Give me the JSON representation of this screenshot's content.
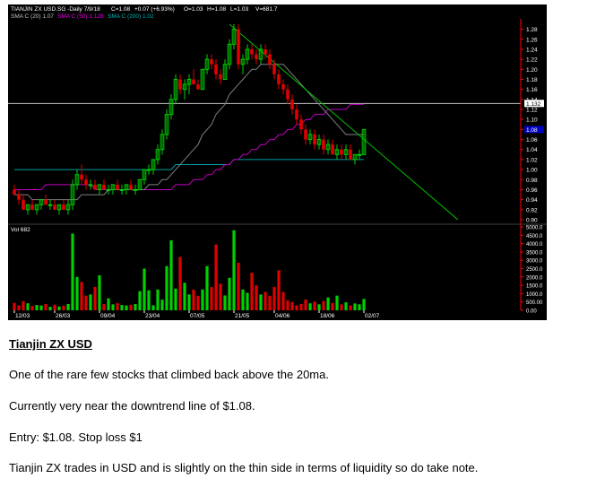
{
  "chart_data": {
    "type": "candlestick",
    "header": {
      "symbol": "TIANJIN ZX USD.SG -Daily  7/9/18",
      "close": "C=1.08",
      "change": "+0.07 (+6.93%)",
      "open": "O=1.03",
      "high": "H=1.08",
      "low": "L=1.03",
      "volume": "V=681.7"
    },
    "ma_legend": {
      "ma20": "SMA C (20) 1.07",
      "ma50": "SMA C (50) 1.128",
      "ma200": "SMA C (200) 1.02"
    },
    "price_axis": {
      "range": [
        0.9,
        1.29
      ],
      "ticks": [
        "1.28",
        "1.26",
        "1.24",
        "1.22",
        "1.20",
        "1.18",
        "1.16",
        "1.14",
        "1.12",
        "1.10",
        "1.08",
        "1.06",
        "1.04",
        "1.02",
        "1.00",
        "0.98",
        "0.96",
        "0.94",
        "0.92",
        "0.90"
      ],
      "tick_values": [
        1.28,
        1.26,
        1.24,
        1.22,
        1.2,
        1.18,
        1.16,
        1.14,
        1.12,
        1.1,
        1.08,
        1.06,
        1.04,
        1.02,
        1.0,
        0.98,
        0.96,
        0.94,
        0.92,
        0.9
      ],
      "marker_line": {
        "value": 1.132,
        "label": "1.132"
      },
      "last_price": {
        "value": 1.08,
        "label": "1.08"
      }
    },
    "volume_legend": "Vol 682",
    "volume_axis": {
      "range": [
        0,
        5000
      ],
      "ticks": [
        "5000.0",
        "4500.0",
        "4000.0",
        "3500.0",
        "3000.0",
        "2500.0",
        "2000.0",
        "1500.0",
        "1000.0",
        "500.00",
        "0.00"
      ],
      "tick_values": [
        5000,
        4500,
        4000,
        3500,
        3000,
        2500,
        2000,
        1500,
        1000,
        500,
        0
      ]
    },
    "x_labels": [
      {
        "label": "12/03",
        "index": 0
      },
      {
        "label": "26/03",
        "index": 9
      },
      {
        "label": "09/04",
        "index": 19
      },
      {
        "label": "23/04",
        "index": 29
      },
      {
        "label": "07/05",
        "index": 39
      },
      {
        "label": "21/05",
        "index": 49
      },
      {
        "label": "04/06",
        "index": 58
      },
      {
        "label": "18/06",
        "index": 68
      },
      {
        "label": "02/07",
        "index": 78
      }
    ],
    "candles": [
      [
        0.96,
        0.97,
        0.95,
        0.95
      ],
      [
        0.95,
        0.96,
        0.93,
        0.94
      ],
      [
        0.94,
        0.95,
        0.92,
        0.92
      ],
      [
        0.92,
        0.93,
        0.91,
        0.93
      ],
      [
        0.93,
        0.94,
        0.92,
        0.92
      ],
      [
        0.92,
        0.93,
        0.91,
        0.93
      ],
      [
        0.93,
        0.94,
        0.92,
        0.94
      ],
      [
        0.94,
        0.95,
        0.93,
        0.93
      ],
      [
        0.93,
        0.94,
        0.92,
        0.93
      ],
      [
        0.93,
        0.94,
        0.92,
        0.92
      ],
      [
        0.92,
        0.93,
        0.91,
        0.93
      ],
      [
        0.93,
        0.94,
        0.92,
        0.92
      ],
      [
        0.92,
        0.94,
        0.91,
        0.93
      ],
      [
        0.93,
        0.98,
        0.92,
        0.97
      ],
      [
        0.97,
        1.0,
        0.96,
        0.99
      ],
      [
        0.99,
        1.01,
        0.97,
        0.98
      ],
      [
        0.98,
        0.99,
        0.96,
        0.97
      ],
      [
        0.97,
        0.98,
        0.96,
        0.97
      ],
      [
        0.97,
        0.98,
        0.96,
        0.96
      ],
      [
        0.96,
        0.97,
        0.95,
        0.97
      ],
      [
        0.97,
        0.98,
        0.96,
        0.96
      ],
      [
        0.96,
        0.97,
        0.95,
        0.96
      ],
      [
        0.96,
        0.97,
        0.95,
        0.97
      ],
      [
        0.97,
        0.98,
        0.96,
        0.96
      ],
      [
        0.96,
        0.97,
        0.95,
        0.96
      ],
      [
        0.96,
        0.97,
        0.95,
        0.97
      ],
      [
        0.97,
        0.98,
        0.96,
        0.96
      ],
      [
        0.96,
        0.97,
        0.95,
        0.96
      ],
      [
        0.96,
        0.98,
        0.96,
        0.98
      ],
      [
        0.98,
        1.0,
        0.97,
        1.0
      ],
      [
        1.0,
        1.01,
        0.99,
        1.0
      ],
      [
        1.0,
        1.02,
        0.99,
        1.02
      ],
      [
        1.02,
        1.05,
        1.01,
        1.04
      ],
      [
        1.04,
        1.08,
        1.03,
        1.07
      ],
      [
        1.07,
        1.12,
        1.06,
        1.11
      ],
      [
        1.11,
        1.15,
        1.1,
        1.14
      ],
      [
        1.14,
        1.19,
        1.13,
        1.18
      ],
      [
        1.18,
        1.19,
        1.15,
        1.16
      ],
      [
        1.16,
        1.18,
        1.14,
        1.17
      ],
      [
        1.17,
        1.19,
        1.15,
        1.18
      ],
      [
        1.18,
        1.2,
        1.17,
        1.17
      ],
      [
        1.17,
        1.18,
        1.16,
        1.16
      ],
      [
        1.16,
        1.2,
        1.16,
        1.2
      ],
      [
        1.2,
        1.23,
        1.19,
        1.22
      ],
      [
        1.22,
        1.23,
        1.2,
        1.21
      ],
      [
        1.21,
        1.22,
        1.18,
        1.19
      ],
      [
        1.19,
        1.2,
        1.17,
        1.18
      ],
      [
        1.18,
        1.22,
        1.18,
        1.21
      ],
      [
        1.21,
        1.26,
        1.2,
        1.25
      ],
      [
        1.25,
        1.29,
        1.24,
        1.28
      ],
      [
        1.28,
        1.29,
        1.2,
        1.21
      ],
      [
        1.21,
        1.23,
        1.19,
        1.22
      ],
      [
        1.22,
        1.25,
        1.21,
        1.24
      ],
      [
        1.24,
        1.25,
        1.22,
        1.23
      ],
      [
        1.23,
        1.24,
        1.21,
        1.22
      ],
      [
        1.22,
        1.25,
        1.21,
        1.24
      ],
      [
        1.24,
        1.25,
        1.22,
        1.23
      ],
      [
        1.23,
        1.24,
        1.2,
        1.21
      ],
      [
        1.21,
        1.22,
        1.18,
        1.19
      ],
      [
        1.19,
        1.2,
        1.16,
        1.17
      ],
      [
        1.17,
        1.18,
        1.15,
        1.16
      ],
      [
        1.16,
        1.17,
        1.13,
        1.14
      ],
      [
        1.14,
        1.15,
        1.11,
        1.12
      ],
      [
        1.12,
        1.13,
        1.09,
        1.1
      ],
      [
        1.1,
        1.11,
        1.07,
        1.08
      ],
      [
        1.08,
        1.09,
        1.05,
        1.06
      ],
      [
        1.06,
        1.08,
        1.05,
        1.07
      ],
      [
        1.07,
        1.08,
        1.04,
        1.05
      ],
      [
        1.05,
        1.07,
        1.04,
        1.06
      ],
      [
        1.06,
        1.07,
        1.03,
        1.04
      ],
      [
        1.04,
        1.06,
        1.03,
        1.05
      ],
      [
        1.05,
        1.06,
        1.03,
        1.03
      ],
      [
        1.03,
        1.05,
        1.02,
        1.04
      ],
      [
        1.04,
        1.05,
        1.02,
        1.03
      ],
      [
        1.03,
        1.05,
        1.02,
        1.04
      ],
      [
        1.04,
        1.05,
        1.02,
        1.02
      ],
      [
        1.02,
        1.03,
        1.01,
        1.03
      ],
      [
        1.03,
        1.04,
        1.02,
        1.03
      ],
      [
        1.03,
        1.08,
        1.03,
        1.08
      ]
    ],
    "volume": [
      450,
      300,
      550,
      420,
      260,
      320,
      290,
      380,
      210,
      340,
      230,
      280,
      380,
      4600,
      2000,
      1700,
      880,
      950,
      1400,
      2100,
      380,
      720,
      360,
      430,
      320,
      290,
      330,
      380,
      1150,
      2500,
      1200,
      300,
      1250,
      640,
      2650,
      4200,
      1300,
      3200,
      1650,
      950,
      1240,
      870,
      1250,
      2650,
      1400,
      3950,
      1600,
      890,
      1950,
      4800,
      2850,
      1250,
      1050,
      2250,
      1500,
      950,
      1100,
      870,
      1400,
      2400,
      1100,
      600,
      500,
      300,
      380,
      650,
      420,
      520,
      360,
      560,
      770,
      440,
      880,
      360,
      480,
      300,
      410,
      360,
      681.7
    ],
    "ma20": [
      0.95,
      0.95,
      0.95,
      0.95,
      0.94,
      0.94,
      0.94,
      0.94,
      0.94,
      0.94,
      0.94,
      0.94,
      0.94,
      0.94,
      0.94,
      0.95,
      0.95,
      0.95,
      0.95,
      0.95,
      0.95,
      0.96,
      0.96,
      0.96,
      0.96,
      0.96,
      0.96,
      0.96,
      0.96,
      0.96,
      0.97,
      0.97,
      0.97,
      0.98,
      0.98,
      0.99,
      1.0,
      1.01,
      1.02,
      1.03,
      1.04,
      1.05,
      1.07,
      1.08,
      1.09,
      1.11,
      1.12,
      1.13,
      1.15,
      1.16,
      1.17,
      1.18,
      1.19,
      1.2,
      1.2,
      1.21,
      1.21,
      1.21,
      1.21,
      1.21,
      1.21,
      1.2,
      1.19,
      1.18,
      1.17,
      1.16,
      1.15,
      1.14,
      1.13,
      1.12,
      1.11,
      1.1,
      1.09,
      1.08,
      1.07,
      1.07,
      1.07,
      1.07,
      1.07
    ],
    "ma50": [
      0.96,
      0.96,
      0.96,
      0.96,
      0.96,
      0.96,
      0.96,
      0.97,
      0.97,
      0.97,
      0.97,
      0.97,
      0.97,
      0.97,
      0.97,
      0.97,
      0.97,
      0.97,
      0.96,
      0.96,
      0.96,
      0.96,
      0.96,
      0.96,
      0.96,
      0.96,
      0.96,
      0.96,
      0.96,
      0.96,
      0.96,
      0.96,
      0.96,
      0.96,
      0.96,
      0.96,
      0.97,
      0.97,
      0.97,
      0.97,
      0.98,
      0.98,
      0.98,
      0.99,
      0.99,
      1.0,
      1.0,
      1.01,
      1.01,
      1.02,
      1.02,
      1.03,
      1.03,
      1.04,
      1.04,
      1.05,
      1.05,
      1.06,
      1.06,
      1.07,
      1.07,
      1.08,
      1.08,
      1.09,
      1.09,
      1.1,
      1.1,
      1.11,
      1.11,
      1.11,
      1.12,
      1.12,
      1.12,
      1.12,
      1.12,
      1.13,
      1.13,
      1.13,
      1.13
    ],
    "ma200": [
      1.0,
      1.0,
      1.0,
      1.0,
      1.0,
      1.0,
      1.0,
      1.0,
      1.0,
      1.0,
      1.0,
      1.0,
      1.0,
      1.0,
      1.0,
      1.0,
      1.0,
      1.0,
      1.0,
      1.0,
      1.0,
      1.0,
      1.0,
      1.0,
      1.0,
      1.0,
      1.0,
      1.0,
      1.0,
      1.0,
      1.0,
      1.0,
      1.0,
      1.0,
      1.0,
      1.0,
      1.01,
      1.01,
      1.01,
      1.01,
      1.01,
      1.01,
      1.01,
      1.01,
      1.01,
      1.01,
      1.01,
      1.01,
      1.01,
      1.02,
      1.02,
      1.02,
      1.02,
      1.02,
      1.02,
      1.02,
      1.02,
      1.02,
      1.02,
      1.02,
      1.02,
      1.02,
      1.02,
      1.02,
      1.02,
      1.02,
      1.02,
      1.02,
      1.02,
      1.02,
      1.02,
      1.02,
      1.02,
      1.02,
      1.02,
      1.02,
      1.02,
      1.02,
      1.02
    ],
    "trendline": {
      "from": {
        "index": 48,
        "value": 1.29
      },
      "to": {
        "index": 99,
        "value": 0.9
      }
    },
    "colors": {
      "up": "#00d000",
      "down": "#e00000",
      "ma20": "#808080",
      "ma50": "#c000c0",
      "ma200": "#00a0a0",
      "trendline": "#00c000",
      "axis": "#ff0000",
      "background": "#000000"
    }
  },
  "article": {
    "title": "Tianjin ZX USD",
    "lines": [
      "One of the rare few stocks that climbed back above the 20ma.",
      "Currently very near the downtrend line of $1.08.",
      "Entry: $1.08. Stop loss $1",
      "Tianjin ZX trades in USD and is slightly on the thin side in terms of liquidity so do take note."
    ]
  }
}
